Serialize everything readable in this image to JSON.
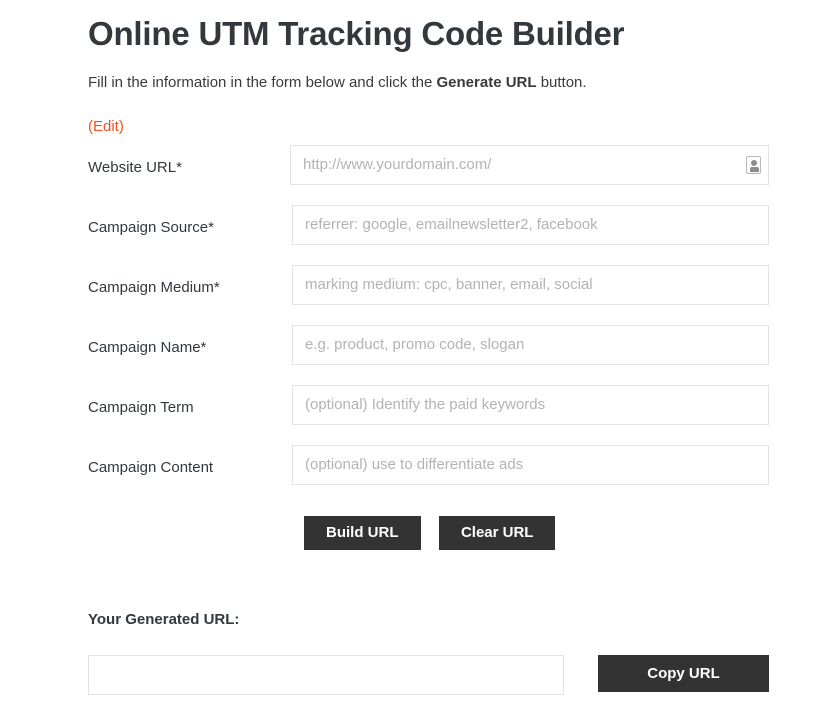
{
  "header": {
    "title": "Online UTM Tracking Code Builder",
    "subtitle_before": "Fill in the information in the form below and click the ",
    "subtitle_strong": "Generate URL",
    "subtitle_after": " button."
  },
  "edit": {
    "label": "(Edit)"
  },
  "form": {
    "fields": [
      {
        "label": "Website URL*",
        "value": "",
        "placeholder": "http://www.yourdomain.com/",
        "name": "website-url",
        "icon": "password-manager-icon"
      },
      {
        "label": "Campaign Source*",
        "value": "",
        "placeholder": "referrer: google, emailnewsletter2, facebook",
        "name": "campaign-source",
        "icon": ""
      },
      {
        "label": "Campaign Medium*",
        "value": "",
        "placeholder": "marking medium: cpc, banner, email, social",
        "name": "campaign-medium",
        "icon": ""
      },
      {
        "label": "Campaign Name*",
        "value": "",
        "placeholder": "e.g. product, promo code, slogan",
        "name": "campaign-name",
        "icon": ""
      },
      {
        "label": "Campaign Term",
        "value": "",
        "placeholder": "(optional) Identify the paid keywords",
        "name": "campaign-term",
        "icon": ""
      },
      {
        "label": "Campaign Content",
        "value": "",
        "placeholder": "(optional) use to differentiate ads",
        "name": "campaign-content",
        "icon": ""
      }
    ]
  },
  "actions": {
    "build_label": "Build URL",
    "clear_label": "Clear URL"
  },
  "result": {
    "title": "Your Generated URL:",
    "value": "",
    "placeholder": "",
    "copy_label": "Copy URL"
  },
  "colors": {
    "accent": "#f4511e",
    "button": "#333333",
    "text": "#33383d",
    "placeholder": "#b3b3b3",
    "border": "#e3e3e3"
  }
}
